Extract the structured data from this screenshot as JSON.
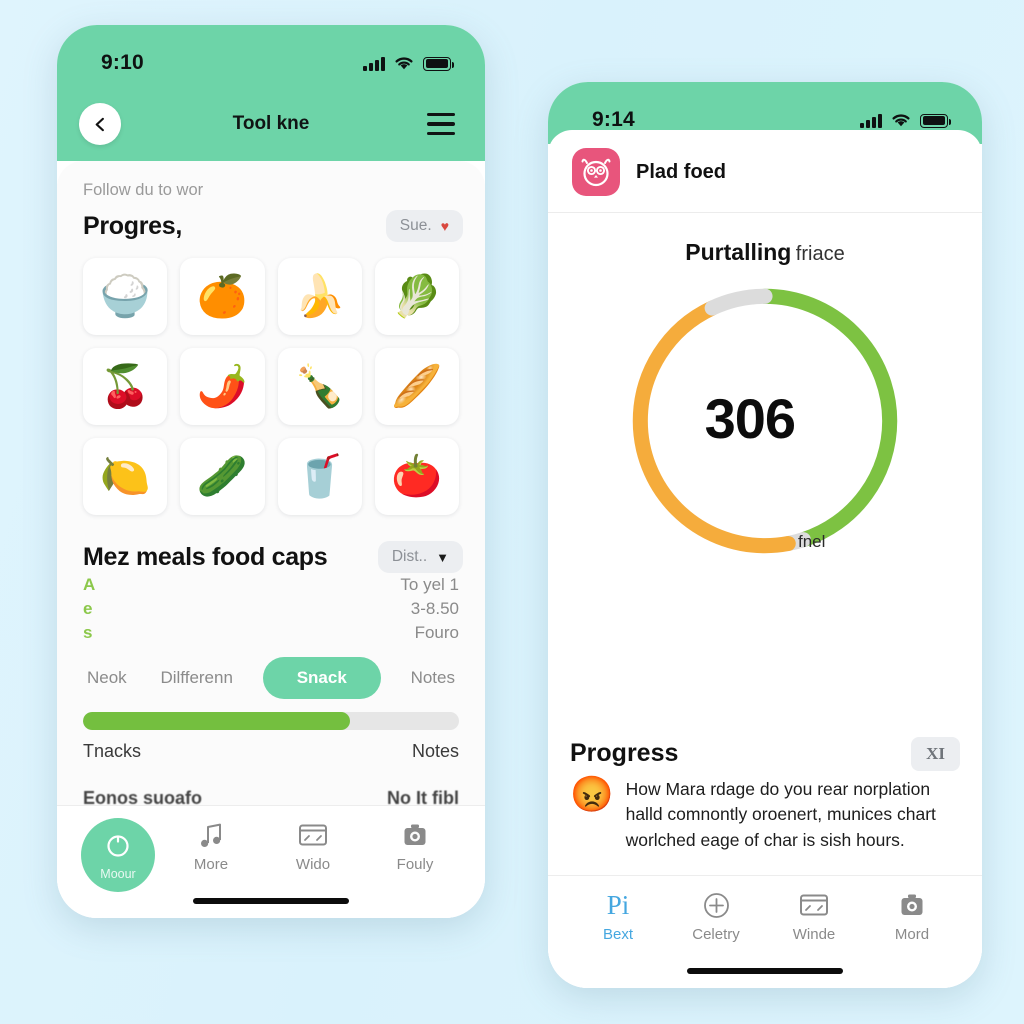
{
  "background_color": "#ddf4fd",
  "accent_green": "#6dd4a8",
  "left_phone": {
    "status": {
      "time": "9:10",
      "signal_icon": "cellular-signal-icon",
      "wifi_icon": "wifi-icon",
      "battery_icon": "battery-full-icon"
    },
    "navbar": {
      "back_icon": "chevron-left-icon",
      "title": "Tool kne",
      "menu_icon": "hamburger-menu-icon"
    },
    "sheet": {
      "hint": "Follow du to wor",
      "progress_section": {
        "title": "Progres,",
        "chip_label": "Sue.",
        "chip_icon": "heart-icon"
      },
      "food_grid": [
        {
          "name": "rice-bowl",
          "glyph": "🍚"
        },
        {
          "name": "tangerine",
          "glyph": "🍊"
        },
        {
          "name": "bananas",
          "glyph": "🍌"
        },
        {
          "name": "radish",
          "glyph": "🥬"
        },
        {
          "name": "cherries",
          "glyph": "🍒"
        },
        {
          "name": "hot-pepper",
          "glyph": "🌶️"
        },
        {
          "name": "bottle-drink",
          "glyph": "🍾"
        },
        {
          "name": "bread-roll",
          "glyph": "🥖"
        },
        {
          "name": "lemon",
          "glyph": "🍋"
        },
        {
          "name": "cucumber",
          "glyph": "🥒"
        },
        {
          "name": "blue-drink",
          "glyph": "🥤"
        },
        {
          "name": "tomatoes",
          "glyph": "🍅"
        }
      ],
      "meals_section": {
        "title": "Mez meals food caps",
        "chip_label": "Dist..",
        "chip_icon": "chevron-down-icon",
        "rows": [
          {
            "key": "A",
            "value": "To yel 1"
          },
          {
            "key": "e",
            "value": "3-8.50"
          },
          {
            "key": "s",
            "value": "Fouro"
          }
        ]
      },
      "tabs": [
        {
          "label": "Neok",
          "active": false
        },
        {
          "label": "Dilfferenn",
          "active": false
        },
        {
          "label": "Snack",
          "active": true
        },
        {
          "label": "Notes",
          "active": false
        }
      ],
      "progress_bar": {
        "percent": 71
      },
      "footer_row": {
        "left": "Tnacks",
        "right": "Notes"
      },
      "cutoff_row": {
        "left": "Eonos suoafo",
        "right": "No It fibl"
      }
    },
    "tabbar": [
      {
        "name": "record-button",
        "label": "Moour",
        "icon": "record-circle-icon",
        "style": "round"
      },
      {
        "name": "more-tab",
        "label": "More",
        "icon": "music-note-icon",
        "style": "plain"
      },
      {
        "name": "wido-tab",
        "label": "Wido",
        "icon": "dashboard-gauge-icon",
        "style": "plain"
      },
      {
        "name": "fouly-tab",
        "label": "Fouly",
        "icon": "camera-icon",
        "style": "plain"
      }
    ]
  },
  "right_phone": {
    "status": {
      "time": "9:14",
      "signal_icon": "cellular-signal-icon",
      "wifi_icon": "wifi-icon",
      "battery_icon": "battery-full-icon"
    },
    "app_row": {
      "icon": "owl-app-icon",
      "name": "Plad foed"
    },
    "ring_section": {
      "title_bold": "Purtalling",
      "title_light": "friace",
      "value": "306",
      "unit": "fnel"
    },
    "progress_section": {
      "title": "Progress",
      "badge": "XI",
      "emoji": "😡",
      "text": "How Mara rdage do you rear norplation halld comnontly oroenert, munices chart worlched eage of char is sish hours."
    },
    "tabbar": [
      {
        "name": "bext-tab",
        "label": "Bext",
        "icon": "pi-symbol-icon",
        "glyph": "Pi",
        "active": true
      },
      {
        "name": "celetry-tab",
        "label": "Celetry",
        "icon": "plus-circle-icon",
        "active": false
      },
      {
        "name": "winde-tab",
        "label": "Winde",
        "icon": "dashboard-gauge-icon",
        "active": false
      },
      {
        "name": "mord-tab",
        "label": "Mord",
        "icon": "camera-icon",
        "active": false
      }
    ]
  },
  "chart_data": {
    "type": "pie",
    "title": "Purtalling friace",
    "center_value": "306",
    "center_unit": "fnel",
    "segments": [
      {
        "name": "green",
        "color": "#7dc242",
        "percent": 45
      },
      {
        "name": "gap-bottom",
        "color": "#dcdcdc",
        "percent": 2
      },
      {
        "name": "orange",
        "color": "#f5ac3c",
        "percent": 46
      },
      {
        "name": "gap-top",
        "color": "#dcdcdc",
        "percent": 7
      }
    ],
    "start_angle_deg": -90,
    "hole_ratio": 0.86,
    "legend": "none"
  }
}
